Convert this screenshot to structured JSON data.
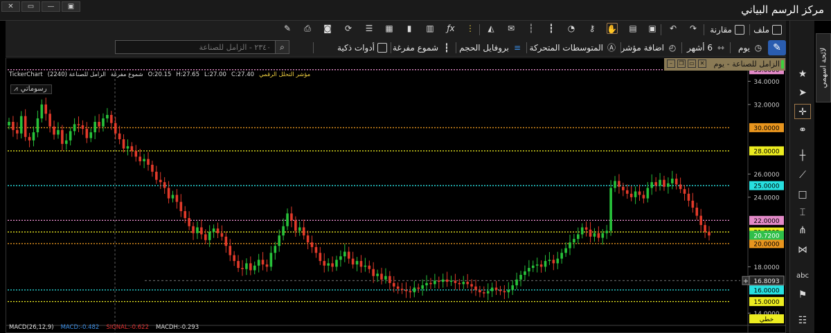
{
  "window": {
    "title": "مركز الرسم البياني",
    "controls": [
      "✕",
      "▭",
      "—",
      "▣"
    ]
  },
  "toolbar": {
    "row1": [
      {
        "label": "ملف",
        "icon": "file-icon"
      },
      {
        "label": "مقارنة",
        "icon": "compare-icon"
      }
    ],
    "row2": {
      "interval": "يوم",
      "period": "6 أشهر",
      "add_indicator": "اضافة مؤشر",
      "moving_averages": "المتوسطات المتحركة",
      "volume_profile": "بروفايل الحجم",
      "hollow_candles": "شموع مفرغة",
      "smart_tools": "أدوات ذكية",
      "search_placeholder": "٢٣٤٠ - الزامل للصناعة"
    }
  },
  "chart_tab": {
    "title": "الزامل للصناعة - يوم"
  },
  "info_bar": {
    "source": "TickerChart",
    "symbol": "(2240) الزامل للصناعة",
    "style": "شموع مفرغة",
    "open": "O:20.15",
    "high": "H:27.65",
    "low": "L:27.00",
    "close": "C:27.40",
    "indicator": "مؤشر التحلل الرقمي"
  },
  "drawings_label": "رسوماتي",
  "macd": {
    "label": "MACD(26,12,9)",
    "macd": "MACD:-0.482",
    "signal": "SIGNAL:-0.622",
    "hist": "MACDH:-0.293",
    "colors": {
      "label": "#dddddd",
      "macd": "#3a8ee6",
      "signal": "#e03030",
      "hist": "#dddddd"
    }
  },
  "chart_data": {
    "type": "candlestick",
    "ylim": [
      13.6,
      35.4
    ],
    "y_ticks": [
      "34.0000",
      "32.0000",
      "26.0000",
      "24.0000",
      "18.0000",
      "14.0000"
    ],
    "y_tick_values": [
      34,
      32,
      26,
      24,
      18,
      14
    ],
    "close_series": [
      30.5,
      29.8,
      29.5,
      31.0,
      29.2,
      28.9,
      29.6,
      30.8,
      32.0,
      31.2,
      30.1,
      29.4,
      29.8,
      28.6,
      28.9,
      29.7,
      30.3,
      30.2,
      29.9,
      29.1,
      29.6,
      30.5,
      30.1,
      30.8,
      31.1,
      30.4,
      29.5,
      29.0,
      28.2,
      28.4,
      28.0,
      27.5,
      27.1,
      27.3,
      26.8,
      26.2,
      25.5,
      25.3,
      24.8,
      23.9,
      24.2,
      23.6,
      22.8,
      22.2,
      21.5,
      20.9,
      21.4,
      20.8,
      20.3,
      21.0,
      21.3,
      20.9,
      20.6,
      19.8,
      19.0,
      18.5,
      17.9,
      17.8,
      18.3,
      17.7,
      18.1,
      18.6,
      18.2,
      18.0,
      19.2,
      19.8,
      20.7,
      21.5,
      22.6,
      22.0,
      21.1,
      21.4,
      20.7,
      20.1,
      19.7,
      19.2,
      18.5,
      18.1,
      18.3,
      18.0,
      18.6,
      18.9,
      19.3,
      18.7,
      18.2,
      18.5,
      18.0,
      18.1,
      17.8,
      17.2,
      17.4,
      16.9,
      17.2,
      16.6,
      16.3,
      16.1,
      16.0,
      15.9,
      15.8,
      16.2,
      16.1,
      16.4,
      16.6,
      16.5,
      16.8,
      16.7,
      16.9,
      16.7,
      16.8,
      16.6,
      16.5,
      16.7,
      16.5,
      16.3,
      16.0,
      15.8,
      15.7,
      15.9,
      16.2,
      16.0,
      15.9,
      15.8,
      16.0,
      16.4,
      16.9,
      17.3,
      17.6,
      17.9,
      18.1,
      18.2,
      18.0,
      18.5,
      18.6,
      18.3,
      18.7,
      19.2,
      19.6,
      20.1,
      20.4,
      20.8,
      21.4,
      21.2,
      20.6,
      20.9,
      20.5,
      20.9,
      21.1,
      24.8,
      25.4,
      24.9,
      24.6,
      24.3,
      24.0,
      24.5,
      24.2,
      23.9,
      24.8,
      25.3,
      25.0,
      25.5,
      24.9,
      25.2,
      25.6,
      25.1,
      24.7,
      24.3,
      23.7,
      23.1,
      22.4,
      21.6,
      21.0,
      20.7
    ],
    "h_lines": [
      {
        "value": 35.0,
        "label": "35.0000",
        "color": "#e38ac8",
        "label_bg": "#e38ac8"
      },
      {
        "value": 30.0,
        "label": "30.0000",
        "color": "#e8951e",
        "label_bg": "#e8951e"
      },
      {
        "value": 28.0,
        "label": "28.0000",
        "color": "#e8e820",
        "label_bg": "#ecec20"
      },
      {
        "value": 25.0,
        "label": "25.0000",
        "color": "#27d5d5",
        "label_bg": "#27e0e0"
      },
      {
        "value": 22.0,
        "label": "22.0000",
        "color": "#e38ac8",
        "label_bg": "#e38ac8"
      },
      {
        "value": 21.0,
        "label": "21.0000",
        "color": "#e8e820",
        "label_bg": "#ecec20"
      },
      {
        "value": 20.0,
        "label": "20.0000",
        "color": "#e8951e",
        "label_bg": "#e8951e"
      },
      {
        "value": 16.0,
        "label": "16.0000",
        "color": "#27d5d5",
        "label_bg": "#27e0e0"
      },
      {
        "value": 15.0,
        "label": "15.0000",
        "color": "#e8e820",
        "label_bg": "#ecec20"
      }
    ],
    "last_price": {
      "value": 20.72,
      "label": "20.7200",
      "color": "#2fbf4a"
    },
    "crosshair": {
      "value": 16.8093,
      "label": "16.8093"
    },
    "line_type_label": "خطي",
    "up_color": "#27c23a",
    "down_color": "#e23a2a"
  },
  "sidebar": {
    "items": [
      "star-icon",
      "cursor-icon",
      "crosshair-icon",
      "link-icon",
      "vertical-line-icon",
      "trendline-icon",
      "rectangle-icon",
      "measure-icon",
      "pattern-icon",
      "zigzag-icon",
      "text-icon",
      "flag-icon",
      "settings-icon"
    ],
    "vertical_tab": "لائحة اسهمي"
  }
}
